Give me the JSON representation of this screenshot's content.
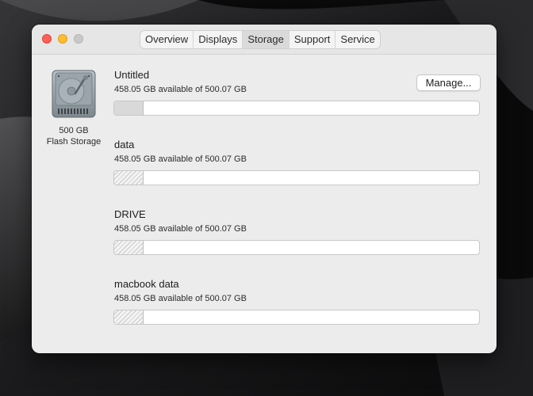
{
  "window": {
    "tabs": [
      {
        "label": "Overview"
      },
      {
        "label": "Displays"
      },
      {
        "label": "Storage",
        "selected": true
      },
      {
        "label": "Support"
      },
      {
        "label": "Service"
      }
    ]
  },
  "disk": {
    "icon": "hard-drive-icon",
    "capacity": "500 GB",
    "type": "Flash Storage"
  },
  "manage_button": "Manage...",
  "volumes": [
    {
      "name": "Untitled",
      "availability": "458.05 GB available of 500.07 GB",
      "used_fraction": 0.08,
      "fill_style": "solid"
    },
    {
      "name": "data",
      "availability": "458.05 GB available of 500.07 GB",
      "used_fraction": 0.08,
      "fill_style": "hatched"
    },
    {
      "name": "DRIVE",
      "availability": "458.05 GB available of 500.07 GB",
      "used_fraction": 0.08,
      "fill_style": "hatched"
    },
    {
      "name": "macbook data",
      "availability": "458.05 GB available of 500.07 GB",
      "used_fraction": 0.08,
      "fill_style": "hatched"
    }
  ],
  "colors": {
    "close": "#fe5f57",
    "minimize": "#febc2e",
    "zoom_disabled": "#c9c9c9"
  }
}
